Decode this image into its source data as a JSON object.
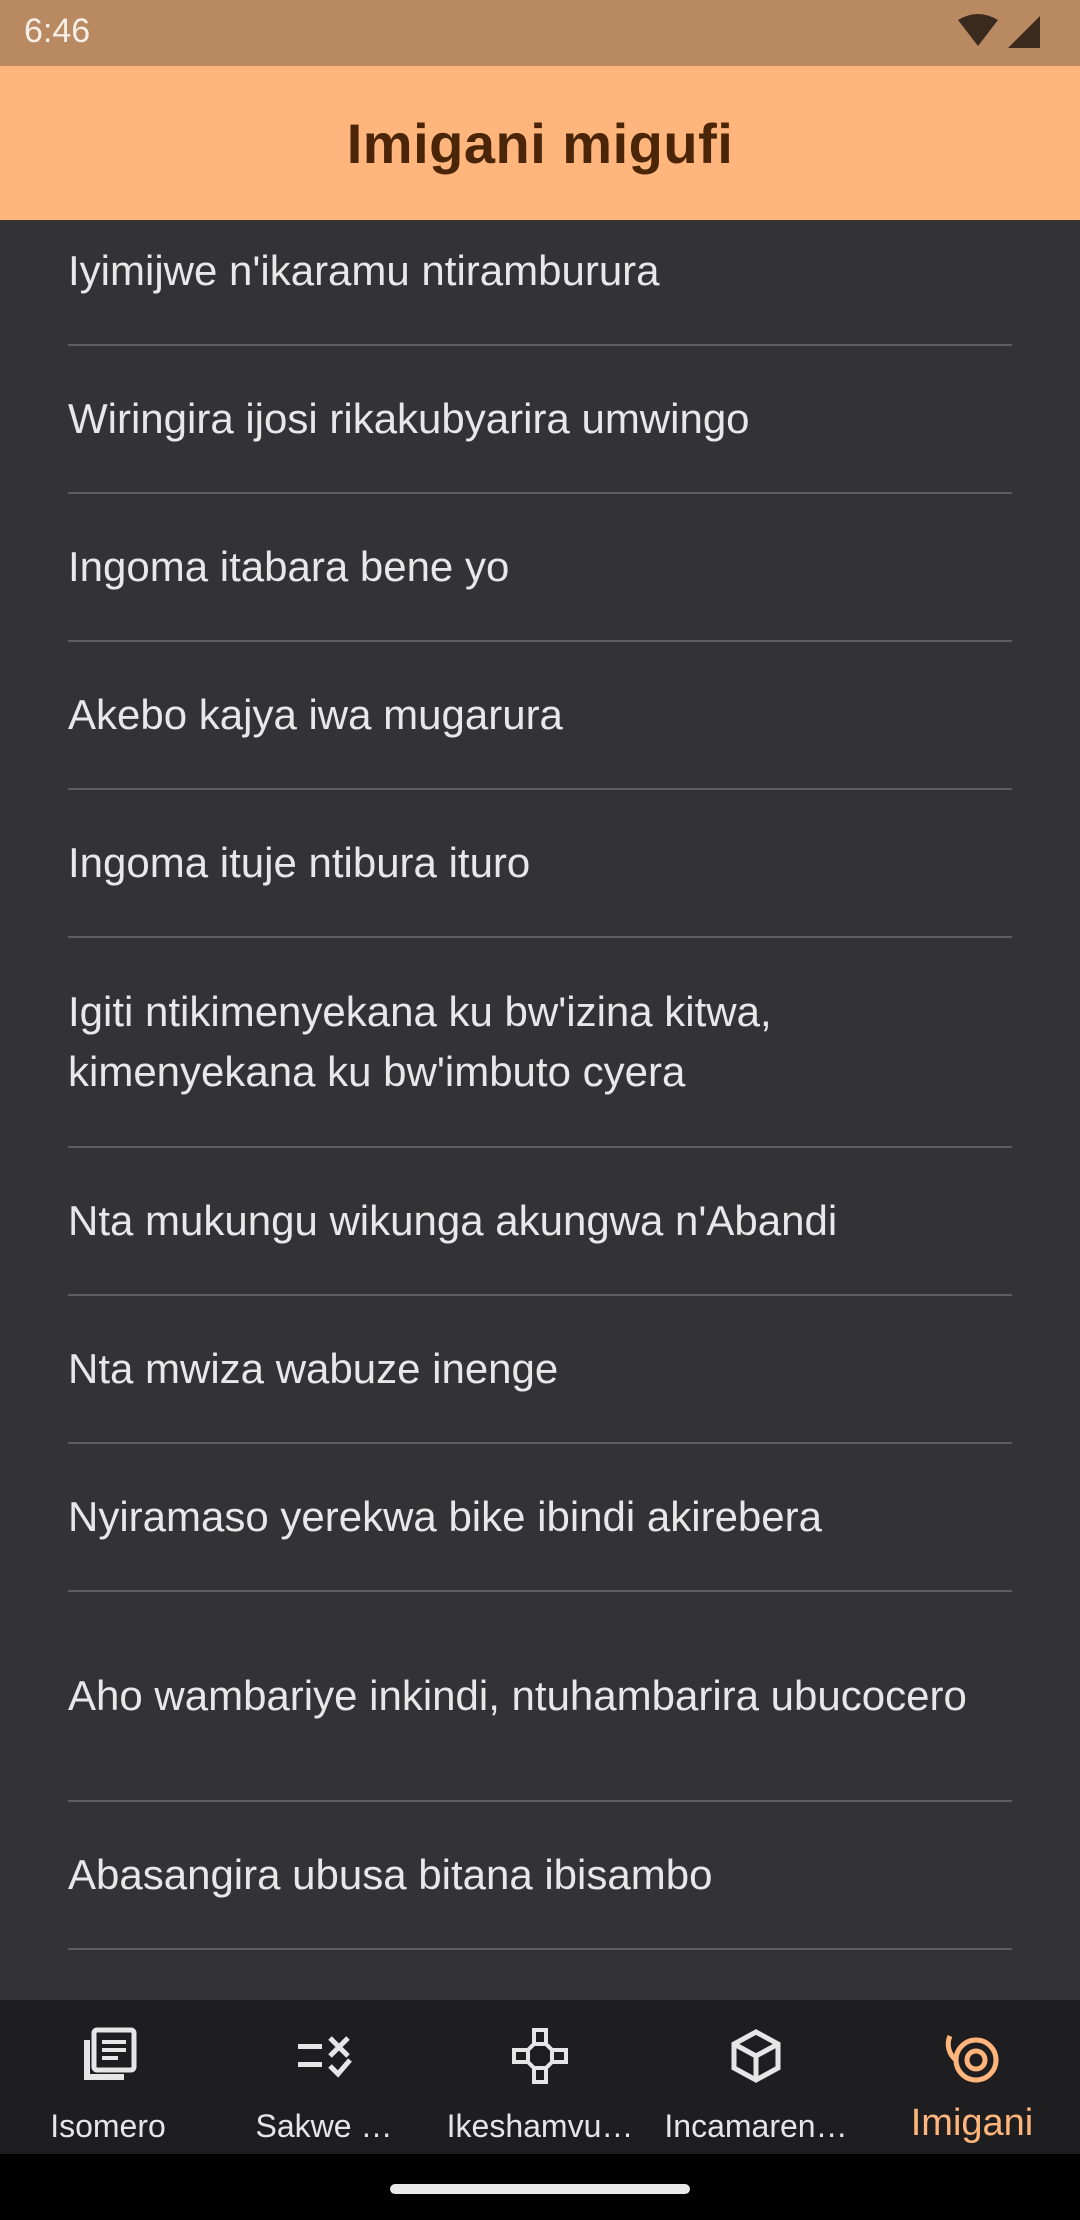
{
  "status_bar": {
    "time": "6:46",
    "icons": [
      "wifi-icon",
      "cell-signal-icon"
    ]
  },
  "app_bar": {
    "title": "Imigani migufi"
  },
  "colors": {
    "status_bar": "#b98a62",
    "app_bar": "#ffb57b",
    "title_text": "#4a2508",
    "background": "#333335",
    "divider": "#5e5e60",
    "bottom_nav": "#1e1e20",
    "active_tab": "#ffb57b"
  },
  "proverbs": [
    "Iyimijwe n'ikaramu ntiramburura",
    "Wiringira ijosi rikakubyarira umwingo",
    "Ingoma itabara bene yo",
    "Akebo kajya iwa mugarura",
    "Ingoma ituje ntibura ituro",
    "Igiti ntikimenyekana ku bw'izina kitwa, kimenyekana ku bw'imbuto cyera",
    "Nta mukungu wikunga akungwa n'Abandi",
    "Nta mwiza wabuze inenge",
    "Nyiramaso yerekwa bike ibindi akirebera",
    "Aho wambariye inkindi, ntuhambarira ubucocero",
    "Abasangira ubusa bitana ibisambo"
  ],
  "bottom_nav": {
    "active_index": 4,
    "items": [
      {
        "label": "Isomero",
        "icon": "library-book-icon"
      },
      {
        "label": "Sakwe …",
        "icon": "quiz-checklist-icon"
      },
      {
        "label": "Ikeshamvu…",
        "icon": "game-controller-icon"
      },
      {
        "label": "Incamaren…",
        "icon": "cube-icon"
      },
      {
        "label": "Imigani",
        "icon": "spiral-icon"
      }
    ]
  }
}
